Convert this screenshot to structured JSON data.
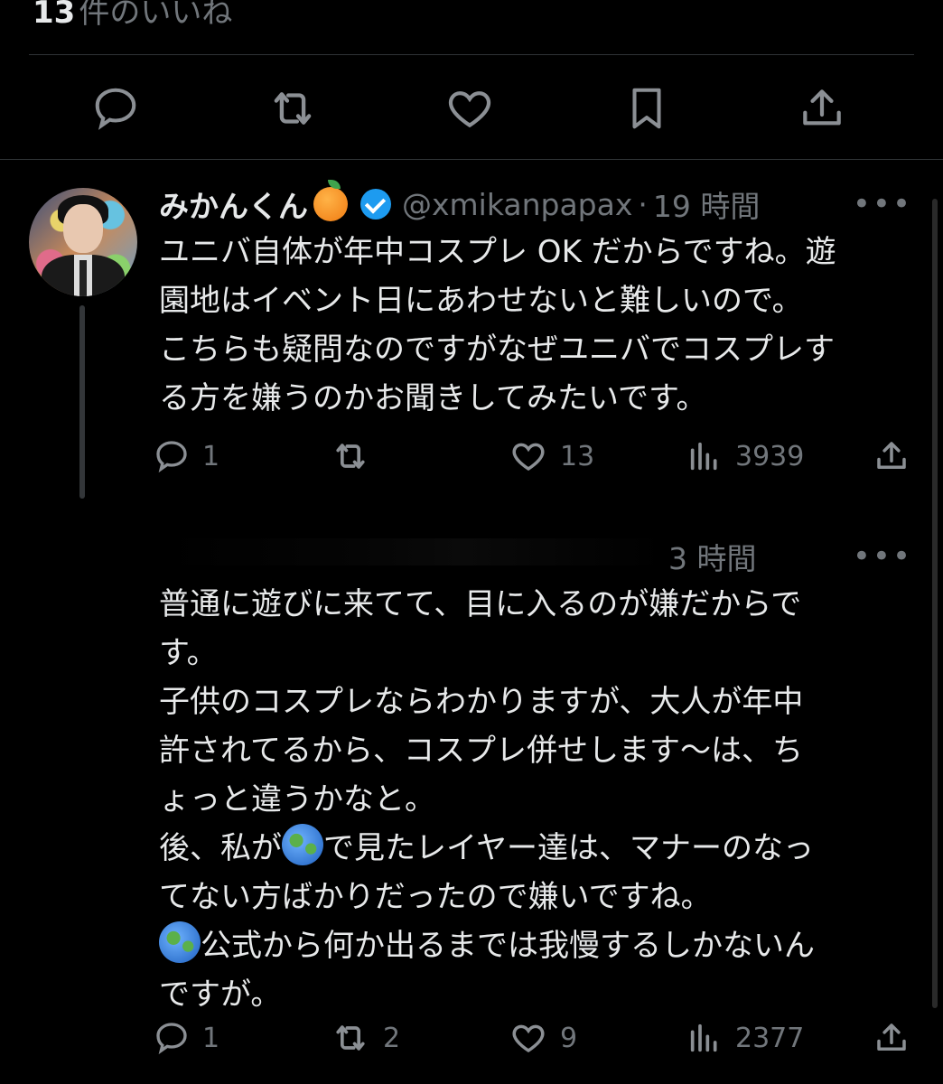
{
  "top": {
    "likes_count": "13",
    "likes_suffix": "件のいいね"
  },
  "tweets": [
    {
      "name": "みかんくん",
      "handle": "@xmikanpapax",
      "separator": "·",
      "time": "19 時間",
      "more": "•••",
      "lines": [
        "ユニバ自体が年中コスプレ OK だからですね。遊",
        "園地はイベント日にあわせないと難しいので。",
        "こちらも疑問なのですがなぜユニバでコスプレす",
        "る方を嫌うのかお聞きしてみたいです。"
      ],
      "actions": {
        "reply": "1",
        "retweet": "",
        "like": "13",
        "views": "3939"
      }
    },
    {
      "time": "3 時間",
      "more": "•••",
      "lines": [
        "普通に遊びに来てて、目に入るのが嫌だからで",
        "す。",
        "子供のコスプレならわかりますが、大人が年中",
        "許されてるから、コスプレ併せします〜は、ち",
        "ょっと違うかなと。"
      ],
      "line6_a": "後、私が",
      "line6_b": "で見たレイヤー達は、マナーのなっ",
      "line7": "てない方ばかりだったので嫌いですね。",
      "line8": "公式から何か出るまでは我慢するしかないん",
      "line9": "ですが。",
      "actions": {
        "reply": "1",
        "retweet": "2",
        "like": "9",
        "views": "2377"
      }
    }
  ],
  "colors": {
    "background": "#000000",
    "text": "#e7e9ea",
    "muted": "#71767b",
    "verified": "#1d9bf0"
  }
}
